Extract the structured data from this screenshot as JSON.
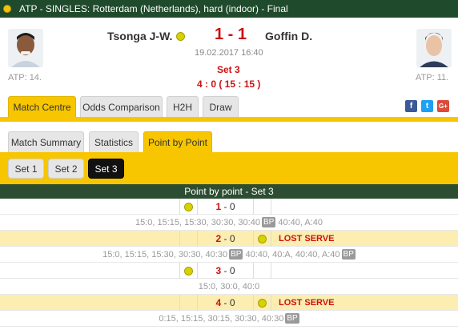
{
  "titlebar": {
    "text": "ATP - SINGLES: Rotterdam (Netherlands), hard (indoor) - Final"
  },
  "match": {
    "home_player": "Tsonga J-W.",
    "away_player": "Goffin D.",
    "score": "1 - 1",
    "datetime": "19.02.2017 16:40",
    "set_label": "Set 3",
    "game_score": "4 : 0 ( 15 : 15 )",
    "home_rank": "ATP: 14.",
    "away_rank": "ATP: 11."
  },
  "main_tabs": [
    "Match Centre",
    "Odds Comparison",
    "H2H",
    "Draw"
  ],
  "main_tab_active": "Match Centre",
  "sub_tabs": [
    "Match Summary",
    "Statistics",
    "Point by Point"
  ],
  "sub_tab_active": "Point by Point",
  "set_buttons": [
    "Set 1",
    "Set 2",
    "Set 3"
  ],
  "set_active": "Set 3",
  "social": {
    "facebook": "f",
    "twitter": "t",
    "google": "G+"
  },
  "pbp": {
    "header": "Point by point - Set 3",
    "bp_label": "BP",
    "games": [
      {
        "score_home": "1",
        "score_sep": " - ",
        "score_away": "0",
        "server": "home",
        "lost_serve": false,
        "note": "",
        "points": [
          {
            "text": "15:0, 15:15, 15:30, 30:30, 30:40",
            "bp": true
          },
          {
            "text": " 40:40, A:40",
            "bp": false
          }
        ]
      },
      {
        "score_home": "2",
        "score_sep": " - ",
        "score_away": "0",
        "server": "away",
        "lost_serve": true,
        "note": "LOST SERVE",
        "points": [
          {
            "text": "15:0, 15:15, 15:30, 30:30, 40:30",
            "bp": true
          },
          {
            "text": " 40:40, 40:A, 40:40, A:40",
            "bp": true
          }
        ]
      },
      {
        "score_home": "3",
        "score_sep": " - ",
        "score_away": "0",
        "server": "home",
        "lost_serve": false,
        "note": "",
        "points": [
          {
            "text": "15:0, 30:0, 40:0",
            "bp": false
          }
        ]
      },
      {
        "score_home": "4",
        "score_sep": " - ",
        "score_away": "0",
        "server": "away",
        "lost_serve": true,
        "note": "LOST SERVE",
        "points": [
          {
            "text": "0:15, 15:15, 30:15, 30:30, 40:30",
            "bp": true
          }
        ]
      }
    ]
  },
  "colors": {
    "accent": "#f7c600",
    "header_green": "#1f4a2b",
    "score_red": "#cc1111",
    "lost_serve_bg": "#fbeeb0"
  }
}
